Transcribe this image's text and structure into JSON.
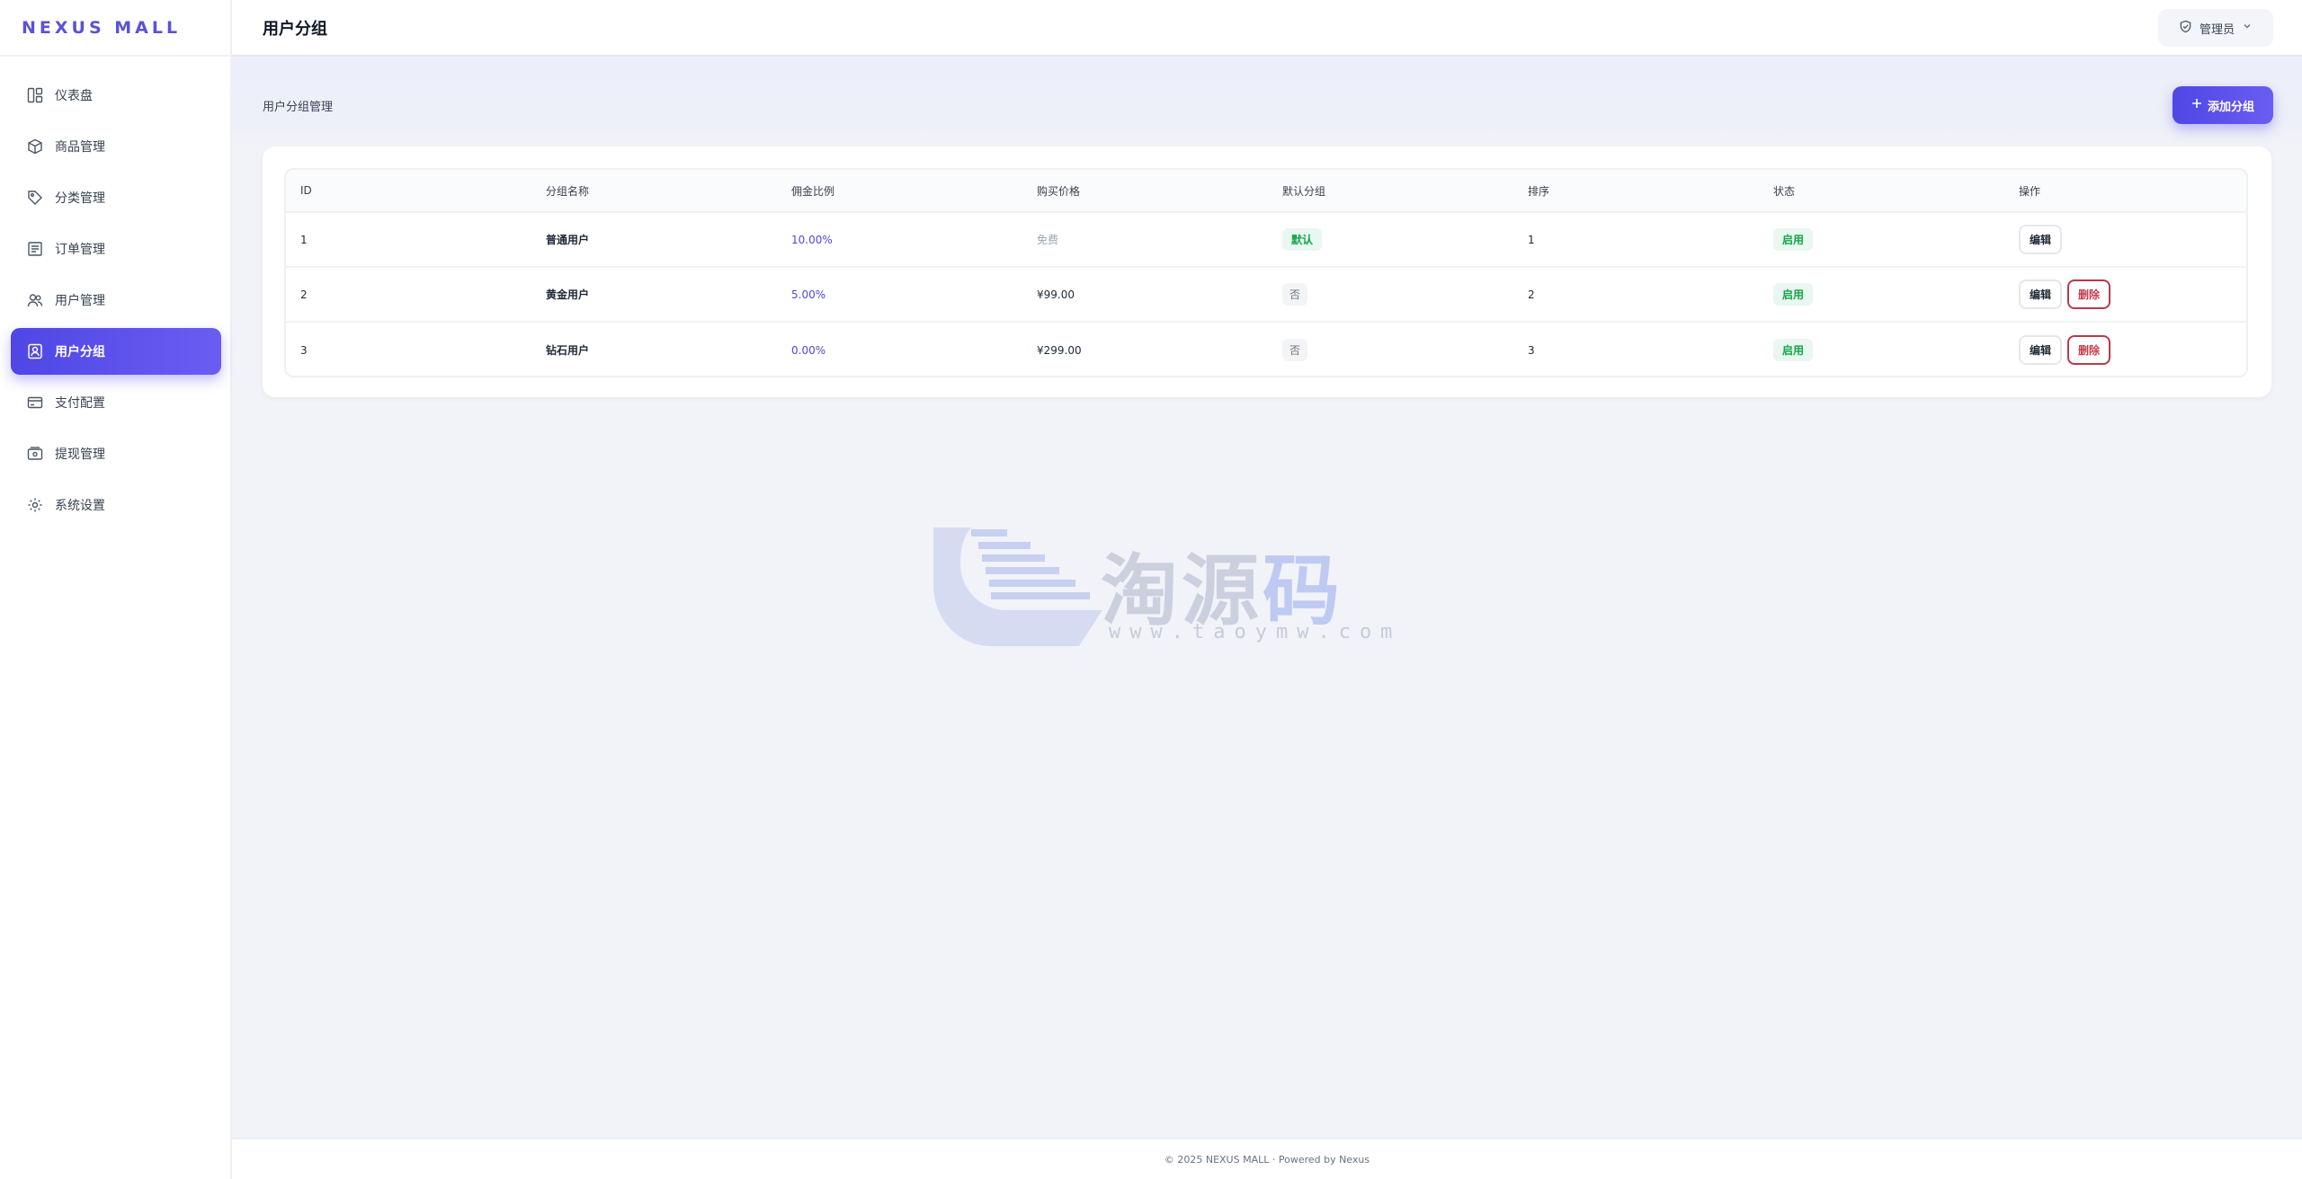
{
  "app": {
    "brand": "NEXUS MALL"
  },
  "sidebar": {
    "items": [
      {
        "label": "仪表盘",
        "icon": "dashboard-icon"
      },
      {
        "label": "商品管理",
        "icon": "box-icon"
      },
      {
        "label": "分类管理",
        "icon": "tag-icon"
      },
      {
        "label": "订单管理",
        "icon": "order-list-icon"
      },
      {
        "label": "用户管理",
        "icon": "users-icon"
      },
      {
        "label": "用户分组",
        "icon": "user-group-icon",
        "active": true
      },
      {
        "label": "支付配置",
        "icon": "credit-card-icon"
      },
      {
        "label": "提现管理",
        "icon": "wallet-icon"
      },
      {
        "label": "系统设置",
        "icon": "gear-icon"
      }
    ]
  },
  "header": {
    "title": "用户分组",
    "admin_label": "管理员"
  },
  "main": {
    "breadcrumb": "用户分组管理",
    "add_button_label": "添加分组",
    "table": {
      "columns": [
        "ID",
        "分组名称",
        "佣金比例",
        "购买价格",
        "默认分组",
        "排序",
        "状态",
        "操作"
      ],
      "rows": [
        {
          "id": "1",
          "name": "普通用户",
          "rate": "10.00%",
          "price": "免费",
          "default": "默认",
          "sort": "1",
          "status": "启用",
          "edit": "编辑"
        },
        {
          "id": "2",
          "name": "黄金用户",
          "rate": "5.00%",
          "price": "¥99.00",
          "default": "否",
          "sort": "2",
          "status": "启用",
          "edit": "编辑",
          "delete": "删除"
        },
        {
          "id": "3",
          "name": "钻石用户",
          "rate": "0.00%",
          "price": "¥299.00",
          "default": "否",
          "sort": "3",
          "status": "启用",
          "edit": "编辑",
          "delete": "删除"
        }
      ]
    }
  },
  "watermark": {
    "text_gray": "淘源",
    "text_accent": "码",
    "url": "www.taoymw.com"
  },
  "footer": {
    "text": "© 2025 NEXUS MALL · Powered by Nexus"
  },
  "colors": {
    "accent": "#4f46e5",
    "success": "#16a34a",
    "danger": "#c53d4f"
  }
}
